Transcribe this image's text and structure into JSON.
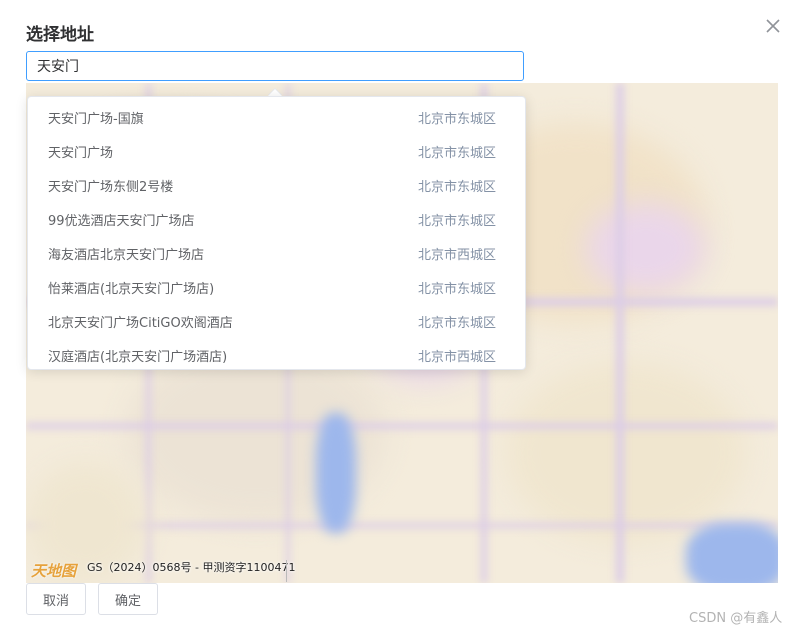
{
  "dialog": {
    "title": "选择地址",
    "close_icon": "close-icon"
  },
  "search": {
    "value": "天安门",
    "placeholder": ""
  },
  "suggestions": [
    {
      "name": "天安门广场-国旗",
      "district": "北京市东城区"
    },
    {
      "name": "天安门广场",
      "district": "北京市东城区"
    },
    {
      "name": "天安门广场东侧2号楼",
      "district": "北京市东城区"
    },
    {
      "name": "99优选酒店天安门广场店",
      "district": "北京市东城区"
    },
    {
      "name": "海友酒店北京天安门广场店",
      "district": "北京市西城区"
    },
    {
      "name": "怡莱酒店(北京天安门广场店)",
      "district": "北京市东城区"
    },
    {
      "name": "北京天安门广场CitiGO欢阁酒店",
      "district": "北京市东城区"
    },
    {
      "name": "汉庭酒店(北京天安门广场酒店)",
      "district": "北京市西城区"
    }
  ],
  "map": {
    "logo_text": "天地图",
    "copyright": "GS（2024）0568号 - 甲测资字1100471"
  },
  "buttons": {
    "cancel": "取消",
    "confirm": "确定"
  },
  "watermark": "CSDN @有鑫人",
  "colors": {
    "accent": "#409eff",
    "district_text": "#8492a6",
    "item_text": "#606266"
  }
}
